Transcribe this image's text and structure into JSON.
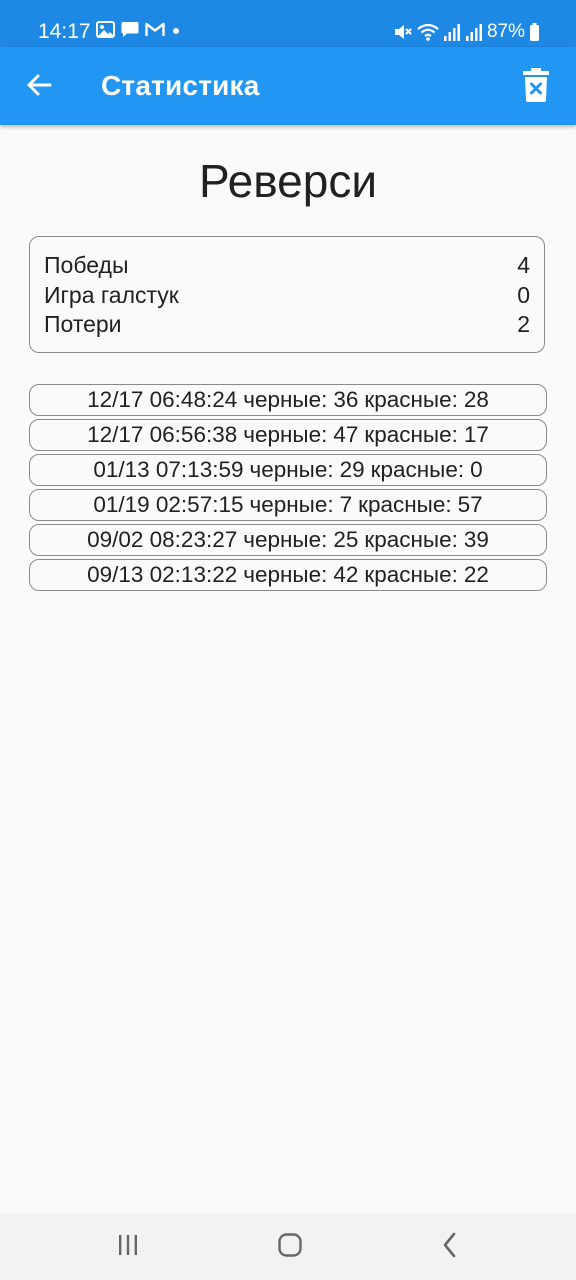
{
  "status_bar": {
    "time": "14:17",
    "battery": "87%",
    "left_icons": [
      "gallery-icon",
      "message-icon",
      "gmail-icon",
      "dot-icon"
    ],
    "right_icons": [
      "mute-icon",
      "wifi-icon",
      "signal-icon",
      "signal-icon",
      "battery-icon"
    ]
  },
  "app_bar": {
    "title": "Статистика",
    "back_icon": "arrow-back-icon",
    "delete_icon": "trash-icon"
  },
  "game": {
    "title": "Реверси"
  },
  "summary": {
    "rows": [
      {
        "label": "Победы",
        "value": "4"
      },
      {
        "label": "Игра галстук",
        "value": "0"
      },
      {
        "label": "Потери",
        "value": "2"
      }
    ]
  },
  "games": [
    {
      "datetime": "12/17 06:48:24",
      "black_label": "черные:",
      "black": "36",
      "red_label": "красные:",
      "red": "28"
    },
    {
      "datetime": "12/17 06:56:38",
      "black_label": "черные:",
      "black": "47",
      "red_label": "красные:",
      "red": "17"
    },
    {
      "datetime": "01/13 07:13:59",
      "black_label": "черные:",
      "black": "29",
      "red_label": "красные:",
      "red": "0"
    },
    {
      "datetime": "01/19 02:57:15",
      "black_label": "черные:",
      "black": "7",
      "red_label": "красные:",
      "red": "57"
    },
    {
      "datetime": "09/02 08:23:27",
      "black_label": "черные:",
      "black": "25",
      "red_label": "красные:",
      "red": "39"
    },
    {
      "datetime": "09/13 02:13:22",
      "black_label": "черные:",
      "black": "42",
      "red_label": "красные:",
      "red": "22"
    }
  ],
  "nav_bar": {
    "icons": [
      "recents-icon",
      "home-icon",
      "back-icon"
    ]
  },
  "colors": {
    "status_bar": "#1e88e5",
    "app_bar": "#2196f3",
    "background": "#fafafa",
    "border": "#8a8a8a"
  }
}
